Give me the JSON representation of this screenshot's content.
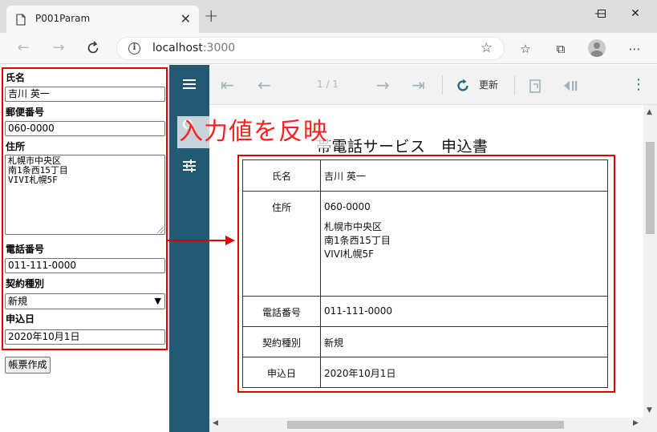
{
  "browser": {
    "tab_title": "P001Param",
    "tab_close": "✕",
    "new_tab": "+",
    "url_host": "localhost",
    "url_port": ":3000",
    "window_minimize": "—",
    "window_maximize": "☐",
    "window_close": "✕"
  },
  "form": {
    "name_label": "氏名",
    "name_value": "吉川 英一",
    "postal_label": "郵便番号",
    "postal_value": "060-0000",
    "address_label": "住所",
    "address_value": "札幌市中央区\n南1条西15丁目\nVIVI札幌5F",
    "phone_label": "電話番号",
    "phone_value": "011-111-0000",
    "contract_label": "契約種別",
    "contract_value": "新規",
    "date_label": "申込日",
    "date_value": "2020年10月1日",
    "submit_label": "帳票作成"
  },
  "viewer": {
    "page_indicator": "1 / 1",
    "refresh_label": "更新",
    "report": {
      "title_visible": "帯電話サービス　申込書",
      "rows": {
        "name_label": "氏名",
        "name_value": "吉川 英一",
        "address_label": "住所",
        "postal_value": "060-0000",
        "address_line1": "札幌市中央区",
        "address_line2": "南1条西15丁目",
        "address_line3": "VIVI札幌5F",
        "phone_label": "電話番号",
        "phone_value": "011-111-0000",
        "contract_label": "契約種別",
        "contract_value": "新規",
        "date_label": "申込日",
        "date_value": "2020年10月1日"
      }
    }
  },
  "annotation": {
    "text": "入力値を反映",
    "color": "#ff2020"
  },
  "colors": {
    "viewer_sidebar": "#215a72",
    "highlight_red": "#e00000"
  }
}
